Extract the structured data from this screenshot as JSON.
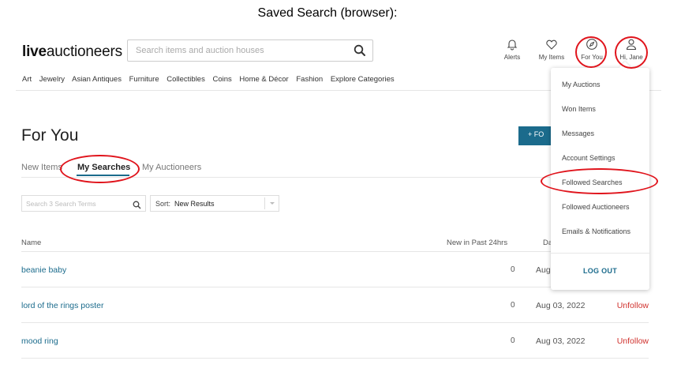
{
  "caption": "Saved Search (browser):",
  "header": {
    "logo_bold": "live",
    "logo_rest": "auctioneers",
    "search_placeholder": "Search items and auction houses",
    "nav": [
      {
        "label": "Alerts",
        "icon": "bell-icon"
      },
      {
        "label": "My Items",
        "icon": "heart-icon"
      },
      {
        "label": "For You",
        "icon": "compass-icon"
      },
      {
        "label": "Hi, Jane",
        "icon": "user-icon"
      }
    ]
  },
  "categories": [
    "Art",
    "Jewelry",
    "Asian Antiques",
    "Furniture",
    "Collectibles",
    "Coins",
    "Home & Décor",
    "Fashion",
    "Explore Categories"
  ],
  "page": {
    "title": "For You",
    "follow_button": "+ FO",
    "tabs": [
      "New Items",
      "My Searches",
      "My Auctioneers"
    ],
    "active_tab": "My Searches"
  },
  "filter": {
    "placeholder": "Search 3 Search Terms",
    "sort_label": "Sort:",
    "sort_value": "New Results"
  },
  "table": {
    "columns": [
      "Name",
      "New in Past 24hrs",
      "Da"
    ],
    "rows": [
      {
        "name": "beanie baby",
        "count": "0",
        "date": "Aug",
        "action": ""
      },
      {
        "name": "lord of the rings poster",
        "count": "0",
        "date": "Aug 03, 2022",
        "action": "Unfollow"
      },
      {
        "name": "mood ring",
        "count": "0",
        "date": "Aug 03, 2022",
        "action": "Unfollow"
      }
    ]
  },
  "dropdown": {
    "items": [
      "My Auctions",
      "Won Items",
      "Messages",
      "Account Settings",
      "Followed Searches",
      "Followed Auctioneers",
      "Emails & Notifications"
    ],
    "logout": "LOG OUT"
  },
  "colors": {
    "accent": "#1b6b8c",
    "unfollow": "#d0312d",
    "annotation": "#e0141c"
  }
}
